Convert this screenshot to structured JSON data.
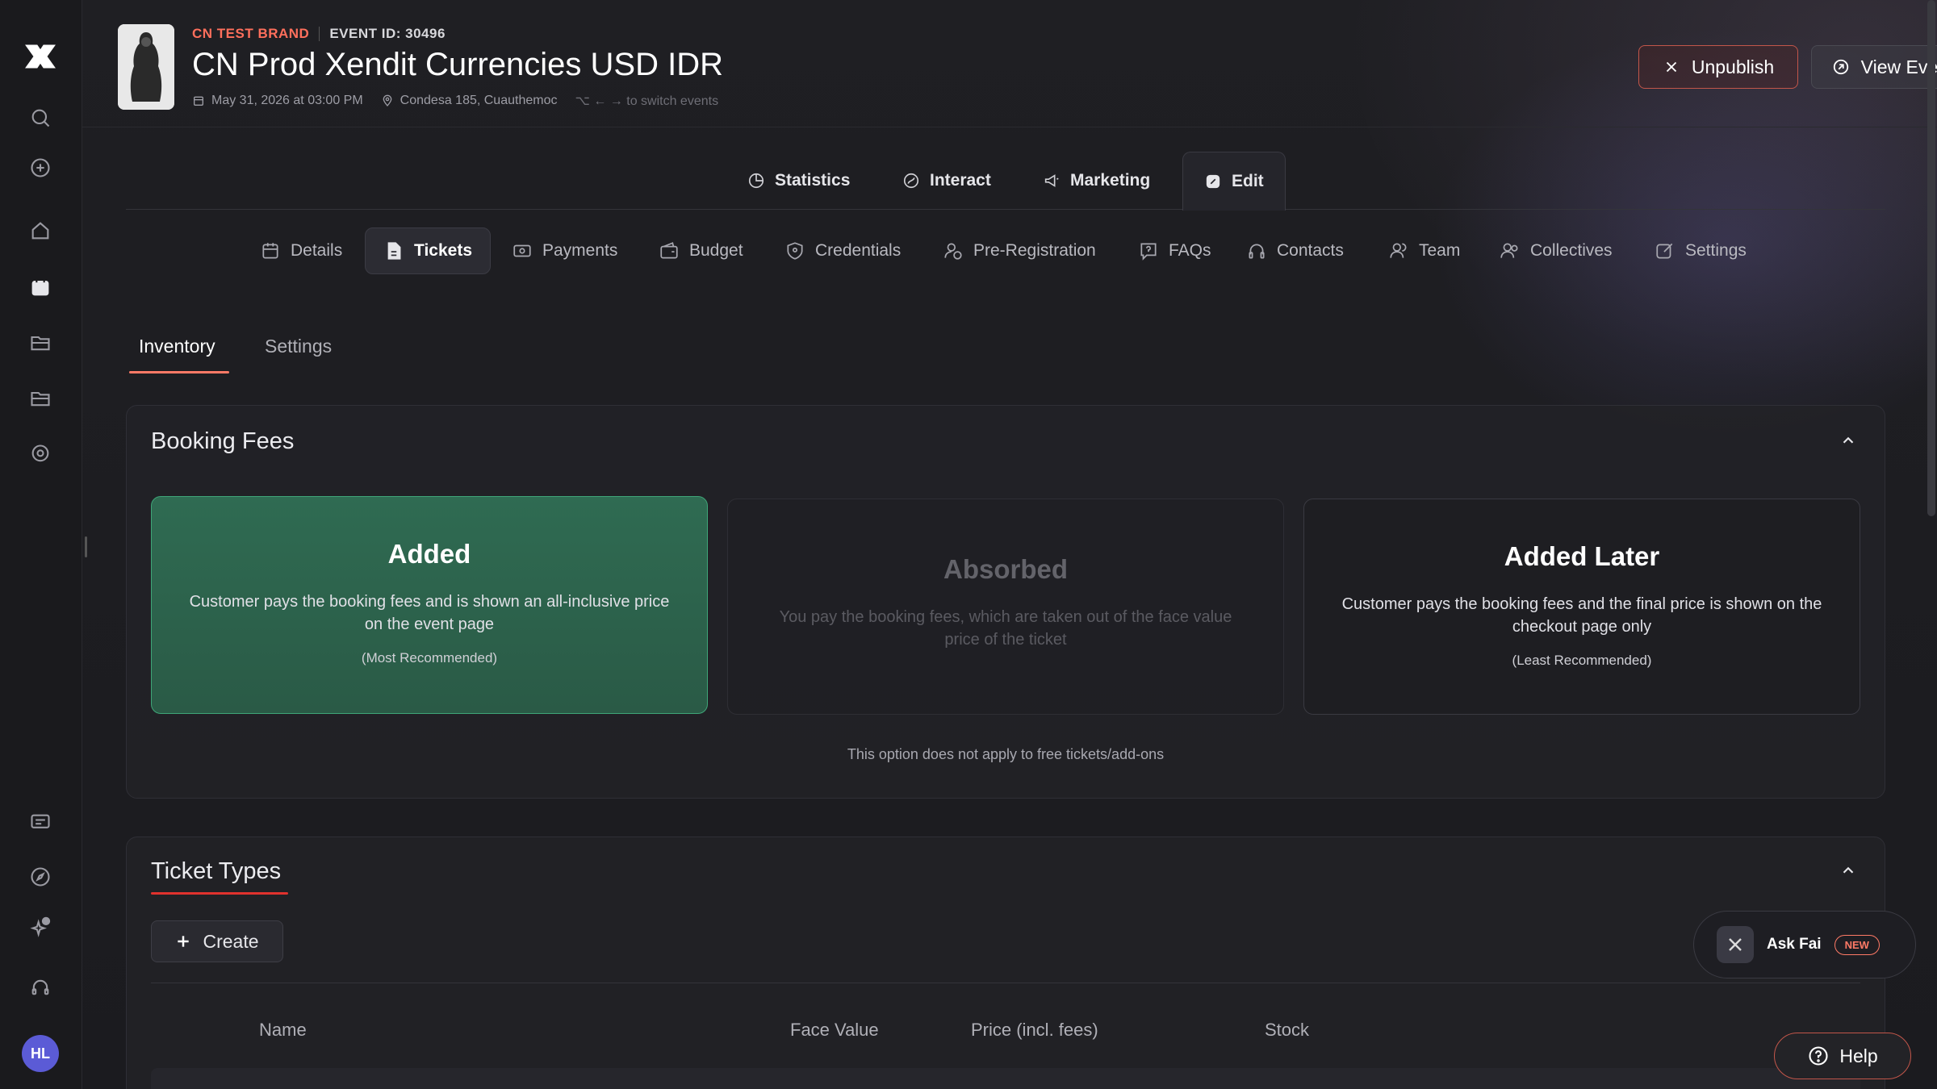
{
  "header": {
    "brand": "CN TEST BRAND",
    "event_id": "EVENT ID: 30496",
    "title": "CN Prod Xendit Currencies USD IDR",
    "date": "May 31, 2026 at 03:00 PM",
    "location": "Condesa 185, Cuauthemoc",
    "switch_hint": "⌥ ← → to switch events",
    "unpublish_label": "Unpublish",
    "view_event_label": "View Event"
  },
  "primary_tabs": [
    {
      "label": "Statistics",
      "icon": "statistics-icon"
    },
    {
      "label": "Interact",
      "icon": "interact-icon"
    },
    {
      "label": "Marketing",
      "icon": "megaphone-icon"
    },
    {
      "label": "Edit",
      "icon": "edit-icon",
      "active": true
    }
  ],
  "secondary_tabs": [
    {
      "label": "Details",
      "icon": "calendar-icon"
    },
    {
      "label": "Tickets",
      "icon": "ticket-icon",
      "active": true
    },
    {
      "label": "Payments",
      "icon": "payments-icon"
    },
    {
      "label": "Budget",
      "icon": "wallet-icon"
    },
    {
      "label": "Credentials",
      "icon": "shield-icon"
    },
    {
      "label": "Pre-Registration",
      "icon": "user-clock-icon"
    },
    {
      "label": "FAQs",
      "icon": "question-icon"
    },
    {
      "label": "Contacts",
      "icon": "headset-icon"
    },
    {
      "label": "Team",
      "icon": "team-icon"
    },
    {
      "label": "Collectives",
      "icon": "collectives-icon"
    },
    {
      "label": "Settings",
      "icon": "settings-edit-icon"
    }
  ],
  "sub_tabs": [
    {
      "label": "Inventory",
      "active": true
    },
    {
      "label": "Settings"
    }
  ],
  "booking_fees": {
    "title": "Booking Fees",
    "options": [
      {
        "title": "Added",
        "description": "Customer pays the booking fees and is shown an all-inclusive price on the event page",
        "recommendation": "(Most Recommended)",
        "state": "selected"
      },
      {
        "title": "Absorbed",
        "description": "You pay the booking fees, which are taken out of the face value price of the ticket",
        "recommendation": "",
        "state": "disabled"
      },
      {
        "title": "Added Later",
        "description": "Customer pays the booking fees and the final price is shown on the checkout page only",
        "recommendation": "(Least Recommended)",
        "state": "default"
      }
    ],
    "note": "This option does not apply to free tickets/add-ons"
  },
  "ticket_types": {
    "title": "Ticket Types",
    "create_label": "Create",
    "columns": [
      "Name",
      "Face Value",
      "Price (incl. fees)",
      "Stock"
    ]
  },
  "ask_fai": {
    "label": "Ask Fai",
    "badge": "NEW"
  },
  "help_label": "Help",
  "user_initials": "HL",
  "colors": {
    "accent": "#ff6f5c",
    "selected_card": "#2f6b52",
    "danger_border": "#c2564a"
  }
}
